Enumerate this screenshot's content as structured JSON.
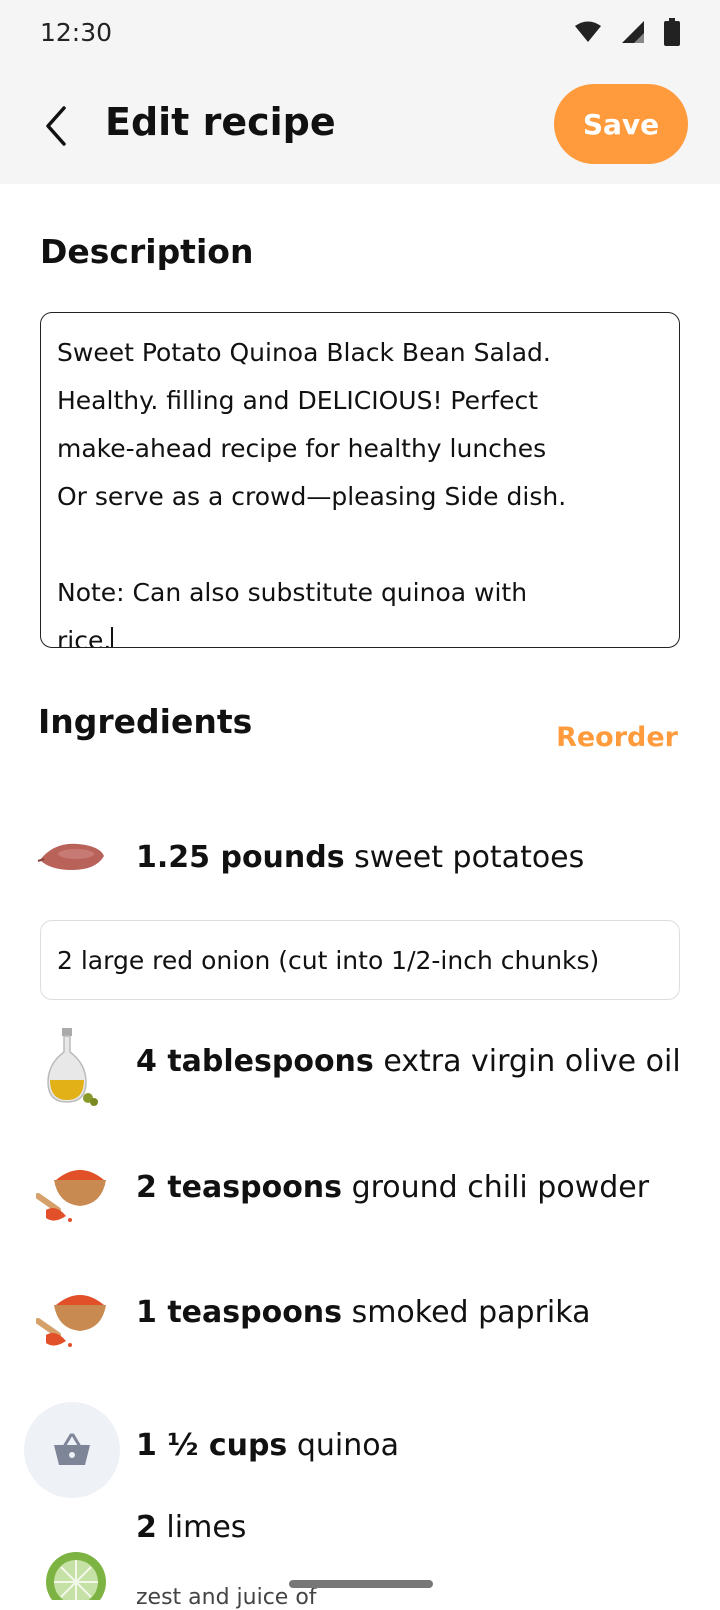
{
  "status": {
    "time": "12:30"
  },
  "appbar": {
    "title": "Edit recipe",
    "save_label": "Save"
  },
  "description": {
    "heading": "Description",
    "text": "Sweet Potato Quinoa Black Bean Salad.\nHealthy. filling and DELICIOUS! Perfect\nmake-ahead recipe for healthy lunches\nOr serve as a crowd—pleasing Side dish.\n\nNote: Can also substitute quinoa with\nrice."
  },
  "ingredients": {
    "heading": "Ingredients",
    "reorder_label": "Reorder",
    "editing_value": "2 large red onion (cut into 1/2-inch chunks)",
    "items": [
      {
        "amount": "1.25 pounds",
        "name": "sweet potatoes",
        "icon": "sweet-potato-icon"
      },
      {
        "amount": "4 tablespoons",
        "name": "extra virgin olive oil",
        "icon": "olive-oil-icon"
      },
      {
        "amount": "2 teaspoons",
        "name": "ground chili powder",
        "icon": "chili-powder-icon"
      },
      {
        "amount": "1 teaspoons",
        "name": "smoked paprika",
        "icon": "paprika-icon"
      },
      {
        "amount": "1 ½ cups",
        "name": "quinoa",
        "icon": "basket-icon"
      },
      {
        "amount": "2",
        "name": "limes",
        "icon": "lime-icon",
        "sub": "zest and juice of"
      }
    ]
  }
}
